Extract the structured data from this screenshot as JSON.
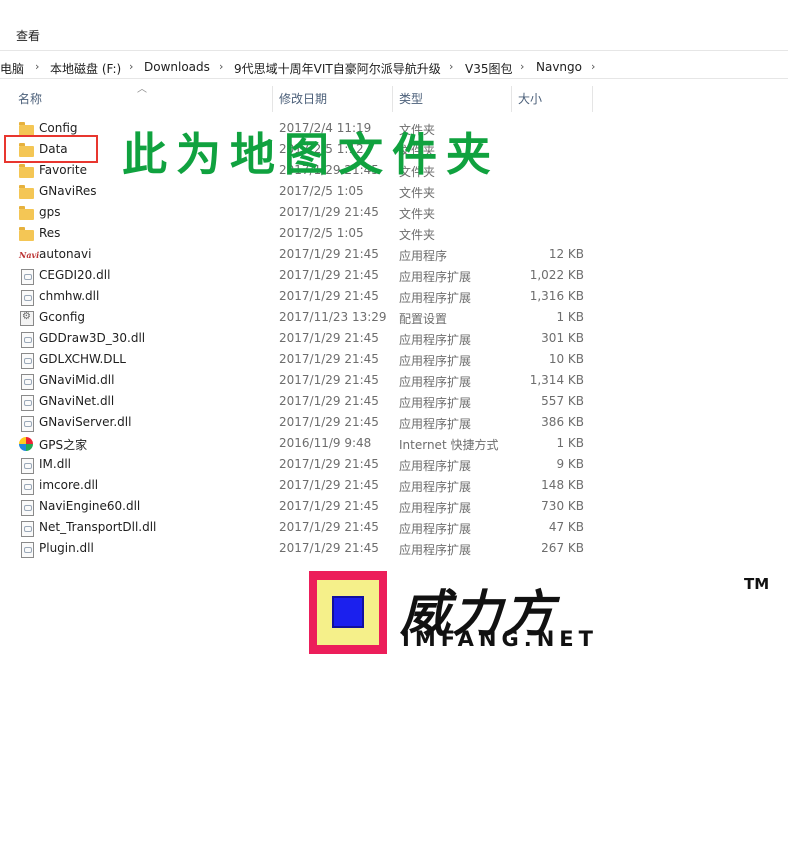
{
  "ribbon": {
    "view_tab": "查看"
  },
  "breadcrumb": {
    "items": [
      "电脑",
      "本地磁盘 (F:)",
      "Downloads",
      "9代思域十周年VIT自豪阿尔派导航升级",
      "V35图包",
      "Navngo"
    ],
    "separator": "›"
  },
  "columns": {
    "name": "名称",
    "date": "修改日期",
    "type": "类型",
    "size": "大小"
  },
  "files": [
    {
      "name": "Config",
      "date": "2017/2/4 11:19",
      "type": "文件夹",
      "size": "",
      "icon": "folder-icon"
    },
    {
      "name": "Data",
      "date": "2017/2/5 1:12",
      "type": "文件夹",
      "size": "",
      "icon": "folder-icon"
    },
    {
      "name": "Favorite",
      "date": "2017/1/29 21:45",
      "type": "文件夹",
      "size": "",
      "icon": "folder-icon"
    },
    {
      "name": "GNaviRes",
      "date": "2017/2/5 1:05",
      "type": "文件夹",
      "size": "",
      "icon": "folder-icon"
    },
    {
      "name": "gps",
      "date": "2017/1/29 21:45",
      "type": "文件夹",
      "size": "",
      "icon": "folder-icon"
    },
    {
      "name": "Res",
      "date": "2017/2/5 1:05",
      "type": "文件夹",
      "size": "",
      "icon": "folder-icon"
    },
    {
      "name": "autonavi",
      "date": "2017/1/29 21:45",
      "type": "应用程序",
      "size": "12 KB",
      "icon": "exe-icon"
    },
    {
      "name": "CEGDI20.dll",
      "date": "2017/1/29 21:45",
      "type": "应用程序扩展",
      "size": "1,022 KB",
      "icon": "dll-icon"
    },
    {
      "name": "chmhw.dll",
      "date": "2017/1/29 21:45",
      "type": "应用程序扩展",
      "size": "1,316 KB",
      "icon": "dll-icon"
    },
    {
      "name": "Gconfig",
      "date": "2017/11/23 13:29",
      "type": "配置设置",
      "size": "1 KB",
      "icon": "config-icon"
    },
    {
      "name": "GDDraw3D_30.dll",
      "date": "2017/1/29 21:45",
      "type": "应用程序扩展",
      "size": "301 KB",
      "icon": "dll-icon"
    },
    {
      "name": "GDLXCHW.DLL",
      "date": "2017/1/29 21:45",
      "type": "应用程序扩展",
      "size": "10 KB",
      "icon": "dll-icon"
    },
    {
      "name": "GNaviMid.dll",
      "date": "2017/1/29 21:45",
      "type": "应用程序扩展",
      "size": "1,314 KB",
      "icon": "dll-icon"
    },
    {
      "name": "GNaviNet.dll",
      "date": "2017/1/29 21:45",
      "type": "应用程序扩展",
      "size": "557 KB",
      "icon": "dll-icon"
    },
    {
      "name": "GNaviServer.dll",
      "date": "2017/1/29 21:45",
      "type": "应用程序扩展",
      "size": "386 KB",
      "icon": "dll-icon"
    },
    {
      "name": "GPS之家",
      "date": "2016/11/9 9:48",
      "type": "Internet 快捷方式",
      "size": "1 KB",
      "icon": "url-shortcut-icon"
    },
    {
      "name": "IM.dll",
      "date": "2017/1/29 21:45",
      "type": "应用程序扩展",
      "size": "9 KB",
      "icon": "dll-icon"
    },
    {
      "name": "imcore.dll",
      "date": "2017/1/29 21:45",
      "type": "应用程序扩展",
      "size": "148 KB",
      "icon": "dll-icon"
    },
    {
      "name": "NaviEngine60.dll",
      "date": "2017/1/29 21:45",
      "type": "应用程序扩展",
      "size": "730 KB",
      "icon": "dll-icon"
    },
    {
      "name": "Net_TransportDll.dll",
      "date": "2017/1/29 21:45",
      "type": "应用程序扩展",
      "size": "47 KB",
      "icon": "dll-icon"
    },
    {
      "name": "Plugin.dll",
      "date": "2017/1/29 21:45",
      "type": "应用程序扩展",
      "size": "267 KB",
      "icon": "dll-icon"
    }
  ],
  "annotation": {
    "text": "此为地图文件夹",
    "color": "#10a23f",
    "box_color": "#e8362f"
  },
  "watermark": {
    "name_cn": "威力方",
    "trademark": "TM",
    "domain": "IMFANG.NET"
  }
}
